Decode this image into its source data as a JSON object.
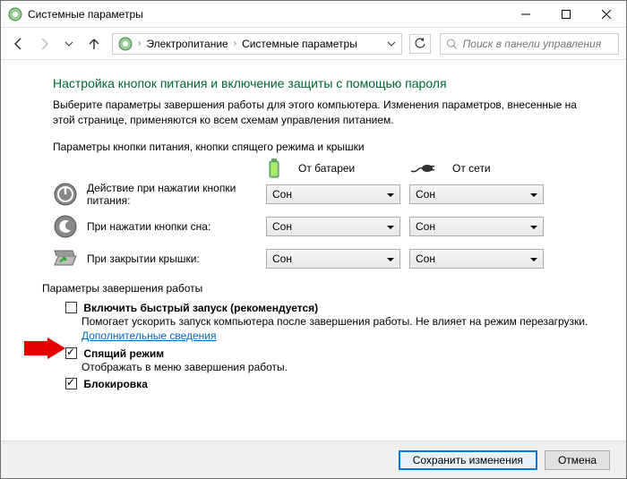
{
  "window": {
    "title": "Системные параметры"
  },
  "breadcrumb": {
    "item1": "Электропитание",
    "item2": "Системные параметры"
  },
  "search": {
    "placeholder": "Поиск в панели управления"
  },
  "page": {
    "heading": "Настройка кнопок питания и включение защиты с помощью пароля",
    "desc": "Выберите параметры завершения работы для этого компьютера. Изменения параметров, внесенные на этой странице, применяются ко всем схемам управления питанием."
  },
  "sectionA": {
    "title": "Параметры кнопки питания, кнопки спящего режима и крышки",
    "col_battery": "От батареи",
    "col_mains": "От сети",
    "rows": [
      {
        "label": "Действие при нажатии кнопки питания:",
        "battery": "Сон",
        "mains": "Сон"
      },
      {
        "label": "При нажатии кнопки сна:",
        "battery": "Сон",
        "mains": "Сон"
      },
      {
        "label": "При закрытии крышки:",
        "battery": "Сон",
        "mains": "Сон"
      }
    ]
  },
  "sectionB": {
    "title": "Параметры завершения работы",
    "items": [
      {
        "label": "Включить быстрый запуск (рекомендуется)",
        "sub": "Помогает ускорить запуск компьютера после завершения работы. Не влияет на режим перезагрузки. ",
        "link": "Дополнительные сведения",
        "checked": false
      },
      {
        "label": "Спящий режим",
        "sub": "Отображать в меню завершения работы.",
        "checked": true
      },
      {
        "label": "Блокировка",
        "checked": true
      }
    ]
  },
  "buttons": {
    "save": "Сохранить изменения",
    "cancel": "Отмена"
  }
}
